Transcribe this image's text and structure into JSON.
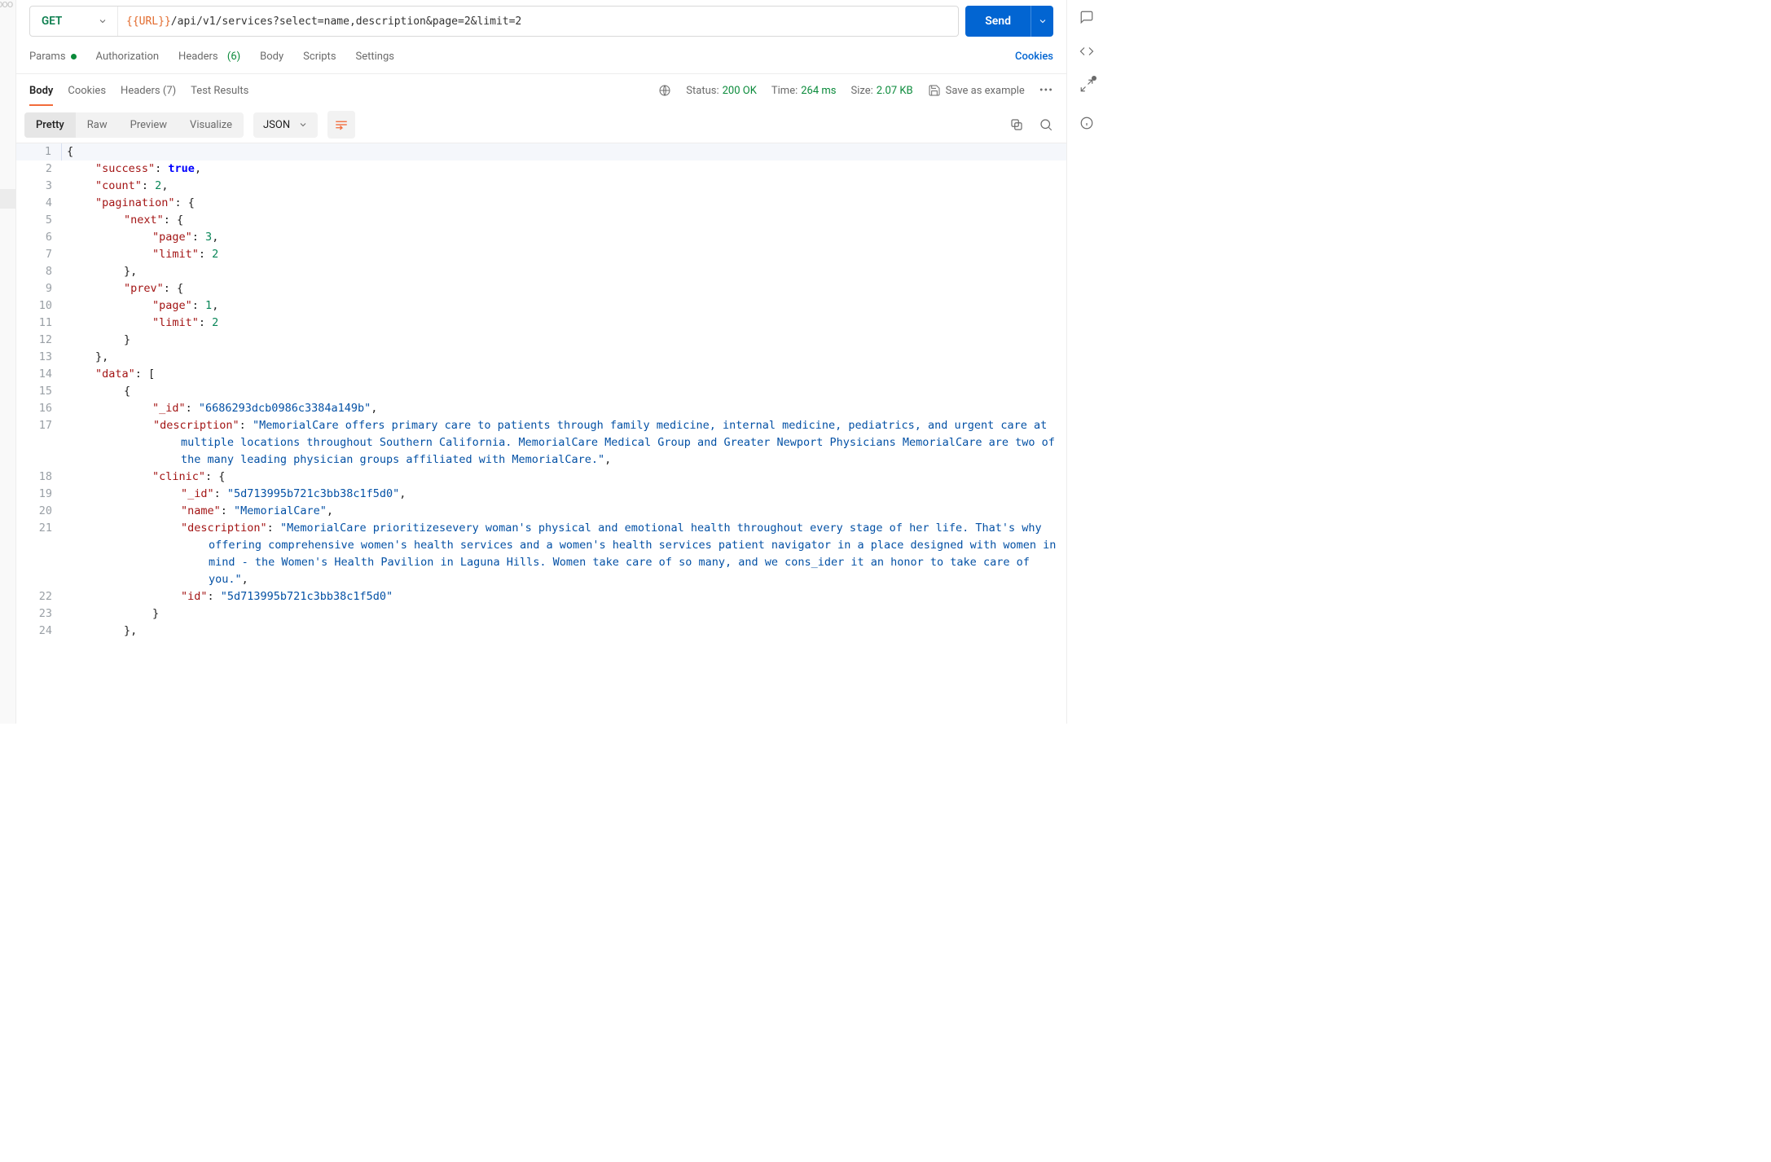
{
  "request": {
    "method": "GET",
    "url_var": "{{URL}}",
    "url_rest": "/api/v1/services?select=name,description&page=2&limit=2",
    "send_label": "Send"
  },
  "req_tabs": {
    "params": "Params",
    "authorization": "Authorization",
    "headers": "Headers",
    "headers_count": "(6)",
    "body": "Body",
    "scripts": "Scripts",
    "settings": "Settings",
    "cookies": "Cookies"
  },
  "res_tabs": {
    "body": "Body",
    "cookies": "Cookies",
    "headers": "Headers",
    "headers_count": "(7)",
    "tests": "Test Results"
  },
  "res_meta": {
    "status_label": "Status:",
    "status_value": "200 OK",
    "time_label": "Time:",
    "time_value": "264 ms",
    "size_label": "Size:",
    "size_value": "2.07 KB",
    "save_example": "Save as example"
  },
  "view": {
    "pretty": "Pretty",
    "raw": "Raw",
    "preview": "Preview",
    "visualize": "Visualize",
    "format": "JSON"
  },
  "body_keys": {
    "success": "\"success\"",
    "count": "\"count\"",
    "pagination": "\"pagination\"",
    "next": "\"next\"",
    "page": "\"page\"",
    "limit": "\"limit\"",
    "prev": "\"prev\"",
    "data": "\"data\"",
    "_id": "\"_id\"",
    "description": "\"description\"",
    "clinic": "\"clinic\"",
    "name": "\"name\"",
    "id": "\"id\""
  },
  "body_values": {
    "success": "true",
    "count": "2",
    "next_page": "3",
    "next_limit": "2",
    "prev_page": "1",
    "prev_limit": "2",
    "item0_id": "\"6686293dcb0986c3384a149b\"",
    "item0_desc": "\"MemorialCare offers primary care to patients through family medicine, internal medicine, pediatrics, and urgent care at multiple locations throughout Southern California. MemorialCare Medical Group and Greater Newport Physicians MemorialCare are two of the many leading physician groups affiliated with MemorialCare.\"",
    "clinic_id": "\"5d713995b721c3bb38c1f5d0\"",
    "clinic_name": "\"MemorialCare\"",
    "clinic_desc": "\"MemorialCare prioritizesevery woman's physical and emotional health throughout every stage of her life. That's why offering comprehensive women's health services and a women's health services patient navigator in a place designed with women in mind - the Women's Health Pavilion in Laguna Hills. Women take care of so many, and we cons_ider it an honor to take care of you.\"",
    "clinic_id2": "\"5d713995b721c3bb38c1f5d0\""
  },
  "line_numbers": [
    "1",
    "2",
    "3",
    "4",
    "5",
    "6",
    "7",
    "8",
    "9",
    "10",
    "11",
    "12",
    "13",
    "14",
    "15",
    "16",
    "17",
    "18",
    "19",
    "20",
    "21",
    "22",
    "23",
    "24"
  ]
}
